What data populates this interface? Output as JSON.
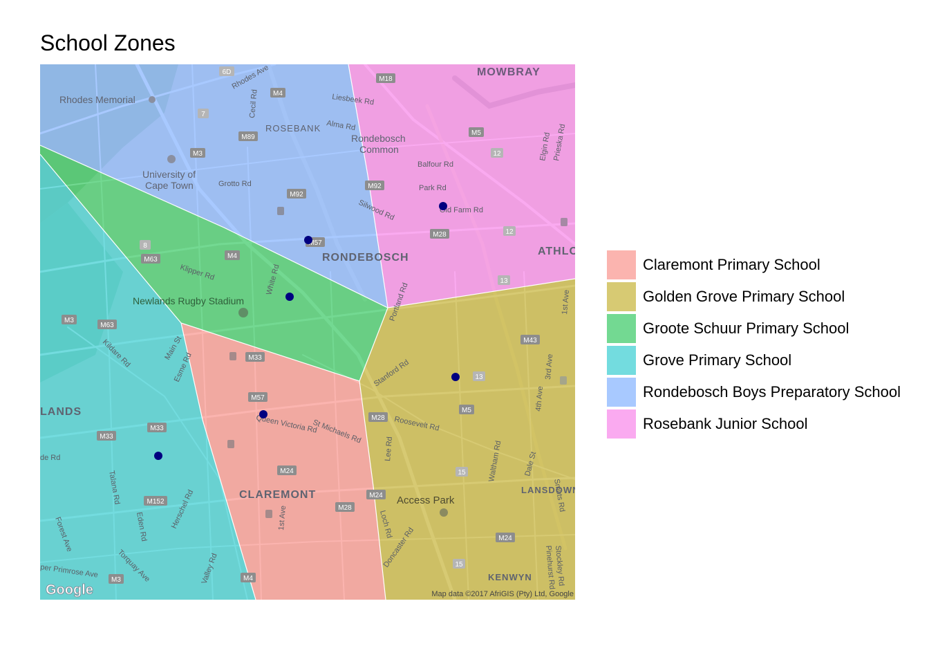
{
  "title": "School Zones",
  "legend": [
    {
      "label": "Claremont Primary School",
      "color": "#F8766D"
    },
    {
      "label": "Golden Grove Primary School",
      "color": "#B79F00"
    },
    {
      "label": "Groote Schuur Primary School",
      "color": "#00BA38"
    },
    {
      "label": "Grove Primary School",
      "color": "#00BFC4"
    },
    {
      "label": "Rondebosch Boys Preparatory School",
      "color": "#619CFF"
    },
    {
      "label": "Rosebank Junior School",
      "color": "#F564E3"
    }
  ],
  "school_marker_color": "#000080",
  "map_labels": {
    "mowbray": "MOWBRAY",
    "rhodes_memorial": "Rhodes Memorial",
    "rosebank": "ROSEBANK",
    "rondebosch_common": "Rondebosch Common",
    "university": "University of Cape Town",
    "rondebosch": "RONDEBOSCH",
    "athlone": "ATHLO",
    "newlands_stadium": "Newlands Rugby Stadium",
    "lands": "LANDS",
    "claremont": "CLAREMONT",
    "access_park": "Access Park",
    "lansdowne": "LANSDOWN",
    "kenwyn": "KENWYN",
    "rhodes_ave": "Rhodes Ave",
    "cecil_rd": "Cecil Rd",
    "alma_rd": "Alma Rd",
    "liesbeek_rd": "Liesbeek Rd",
    "balfour_rd": "Balfour Rd",
    "park_rd": "Park Rd",
    "old_farm_rd": "Old Farm Rd",
    "silwood_rd": "Silwood Rd",
    "grotto_rd": "Grotto Rd",
    "klipper_rd": "Klipper Rd",
    "white_rd": "White Rd",
    "portland_rd": "Portland Rd",
    "stanford_rd": "Stanford Rd",
    "roosevelt_rd": "Roosevelt Rd",
    "queen_victoria_rd": "Queen Victoria Rd",
    "st_michaels_rd": "St Michaels Rd",
    "kildare_rd": "Kildare Rd",
    "main_st": "Main St",
    "esme_rd": "Esme Rd",
    "talana_rd": "Talana Rd",
    "eden_rd": "Eden Rd",
    "herschel_rd": "Herschel Rd",
    "forest_ave": "Forest Ave",
    "torquay_ave": "Torquay Ave",
    "valley_rd": "Valley Rd",
    "upper_primrose_ave": "per Primrose Ave",
    "first_ave": "1st Ave",
    "lee_rd": "Lee Rd",
    "loch_rd": "Loch Rd",
    "doncaster_rd": "Doncaster Rd",
    "waltham_rd": "Waltham Rd",
    "dale_st": "Dale St",
    "smuts_rd": "Smuts Rd",
    "fourth_ave": "4th Ave",
    "third_ave": "3rd Ave",
    "first_ave_east": "1st Ave",
    "elgin_rd": "Elgin Rd",
    "prieska_rd": "Prieska Rd",
    "stockley_rd": "Stockley Rd",
    "pinehurst_rd": "Pinehurst Rd",
    "de_rd": "de Rd"
  },
  "road_shields": {
    "m18": "M18",
    "m4": "M4",
    "m89": "M89",
    "m3": "M3",
    "m5": "M5",
    "r12a": "12",
    "m92a": "M92",
    "m92b": "M92",
    "m57": "M57",
    "m28a": "M28",
    "r12b": "12",
    "m63a": "M63",
    "m4b": "M4",
    "r13": "13",
    "m3b": "M3",
    "m63b": "M63",
    "m33a": "M33",
    "m43": "M43",
    "r13b": "13",
    "m57b": "M57",
    "m5b": "M5",
    "m28b": "M28",
    "m33b": "M33",
    "m33c": "M33",
    "m24": "M24",
    "m152": "M152",
    "m28c": "M28",
    "r15": "15",
    "m24b": "M24",
    "m3c": "M3",
    "r15b": "15",
    "m4c": "M4",
    "m24c": "M24",
    "r8": "8",
    "r7": "7",
    "r6d": "6D"
  },
  "attribution": "Map data ©2017 AfriGIS (Pty) Ltd, Google",
  "logo": "Google"
}
